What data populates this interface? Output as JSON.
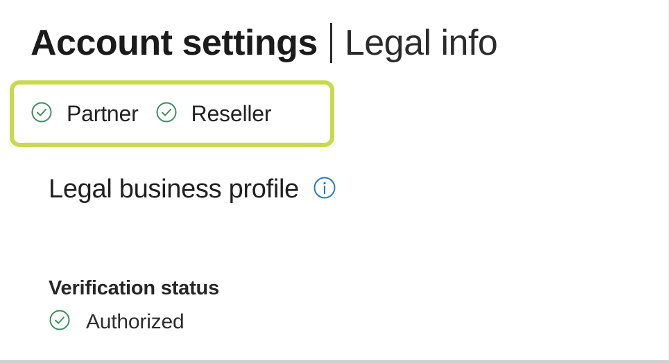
{
  "header": {
    "title": "Account settings",
    "subtitle": "Legal info"
  },
  "program_badges": [
    {
      "label": "Partner",
      "icon": "check-circle-icon",
      "status_color": "#2e8b57"
    },
    {
      "label": "Reseller",
      "icon": "check-circle-icon",
      "status_color": "#2e8b57"
    }
  ],
  "highlight_color": "#c8d94a",
  "legal_profile": {
    "heading": "Legal business profile",
    "info_icon": "info-icon",
    "info_color": "#2b79c2"
  },
  "verification": {
    "label": "Verification status",
    "value": "Authorized",
    "icon": "check-circle-icon"
  }
}
